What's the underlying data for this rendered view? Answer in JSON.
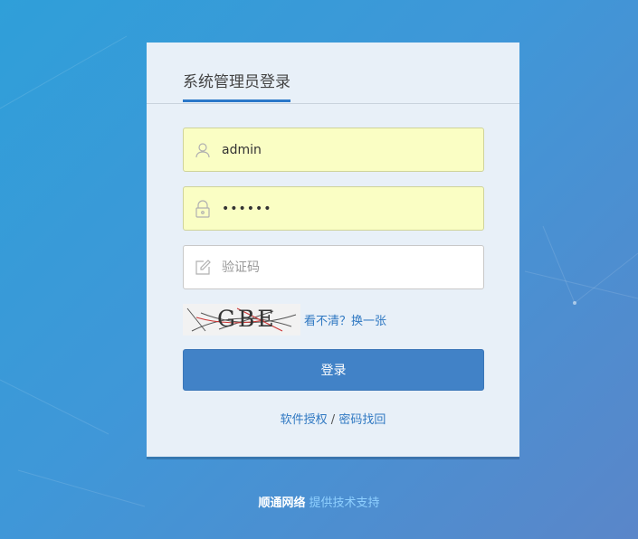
{
  "login": {
    "title": "系统管理员登录",
    "username": {
      "value": "admin",
      "icon": "user-icon"
    },
    "password": {
      "value": "••••••",
      "icon": "lock-icon"
    },
    "captcha": {
      "placeholder": "验证码",
      "icon": "edit-icon",
      "image_text": "GBE",
      "refresh_label": "看不清？换一张"
    },
    "submit_label": "登录",
    "links": {
      "license": "软件授权",
      "separator": "/",
      "recover": "密码找回"
    }
  },
  "footer": {
    "company": "顺通网络",
    "support": "提供技术支持"
  },
  "colors": {
    "accent": "#2b78c9",
    "button": "#4182c7",
    "autofill": "#fafec4",
    "link": "#2f78c2"
  }
}
